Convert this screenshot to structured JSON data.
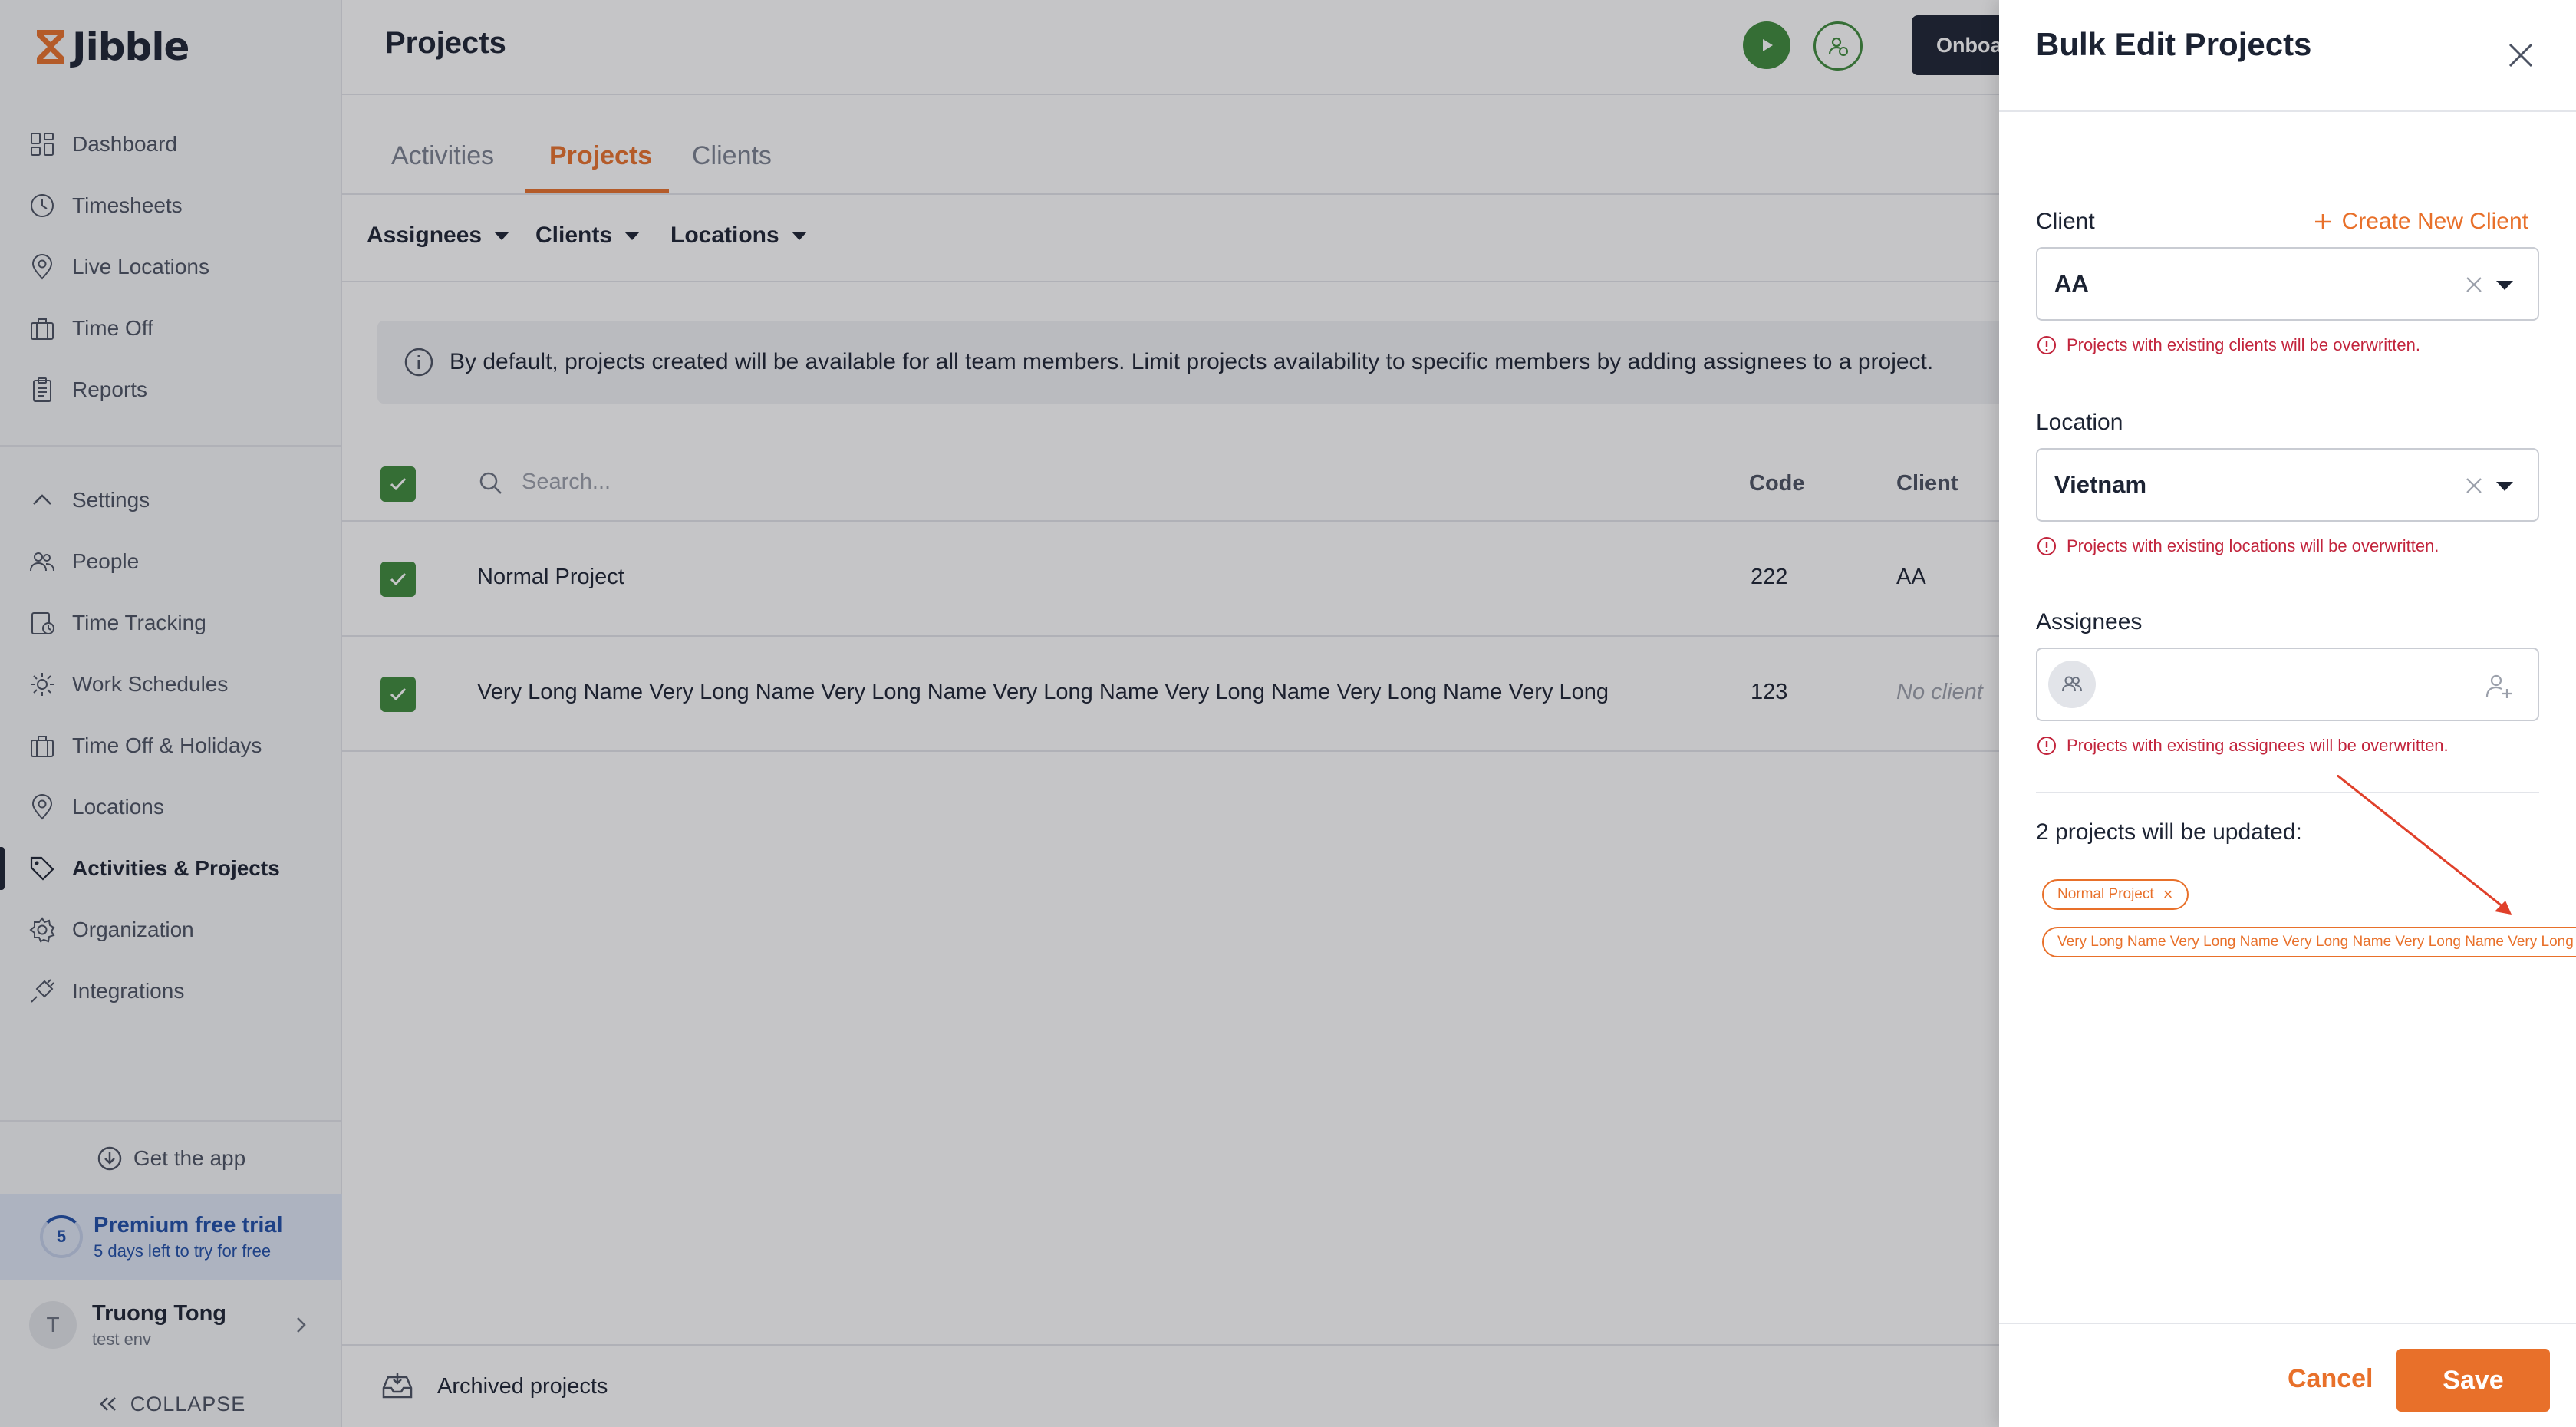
{
  "brand": {
    "name": "Jibble",
    "accent": "#e8702a",
    "green": "#3d8a3a",
    "dark": "#1c2333",
    "error": "#c2243c"
  },
  "sidebar": {
    "primary": [
      {
        "label": "Dashboard",
        "icon": "dashboard-icon"
      },
      {
        "label": "Timesheets",
        "icon": "clock-icon"
      },
      {
        "label": "Live Locations",
        "icon": "location-pin-icon"
      },
      {
        "label": "Time Off",
        "icon": "suitcase-icon"
      },
      {
        "label": "Reports",
        "icon": "clipboard-icon"
      }
    ],
    "settings_label": "Settings",
    "secondary": [
      {
        "label": "People",
        "icon": "people-icon"
      },
      {
        "label": "Time Tracking",
        "icon": "time-tracking-icon"
      },
      {
        "label": "Work Schedules",
        "icon": "schedule-icon"
      },
      {
        "label": "Time Off & Holidays",
        "icon": "suitcase-icon"
      },
      {
        "label": "Locations",
        "icon": "location-pin-icon"
      },
      {
        "label": "Activities & Projects",
        "icon": "tag-icon",
        "active": true
      },
      {
        "label": "Organization",
        "icon": "gear-icon"
      },
      {
        "label": "Integrations",
        "icon": "plug-icon"
      }
    ],
    "get_app": "Get the app",
    "trial": {
      "days": "5",
      "title": "Premium free trial",
      "subtitle": "5 days left to try for free"
    },
    "user": {
      "initial": "T",
      "name": "Truong Tong",
      "org": "test env"
    },
    "collapse": "COLLAPSE"
  },
  "header": {
    "title": "Projects",
    "onboarding_label": "Onboa"
  },
  "tabs": [
    "Activities",
    "Projects",
    "Clients"
  ],
  "filters": [
    "Assignees",
    "Clients",
    "Locations"
  ],
  "info_banner": "By default, projects created will be available for all team members. Limit projects availability to specific members by adding assignees to a project.",
  "table": {
    "search_placeholder": "Search...",
    "columns": [
      "Code",
      "Client"
    ],
    "rows": [
      {
        "name": "Normal Project",
        "code": "222",
        "client": "AA",
        "client_empty": false
      },
      {
        "name": "Very Long Name Very Long Name Very Long Name Very Long Name Very Long Name Very Long Name Very Long",
        "code": "123",
        "client": "No client",
        "client_empty": true
      }
    ]
  },
  "archived_label": "Archived projects",
  "drawer": {
    "title": "Bulk Edit Projects",
    "client_label": "Client",
    "create_client": "Create New Client",
    "client_value": "AA",
    "client_warning": "Projects with existing clients will be overwritten.",
    "location_label": "Location",
    "location_value": "Vietnam",
    "location_warning": "Projects with existing locations will be overwritten.",
    "assignees_label": "Assignees",
    "assignees_warning": "Projects with existing assignees will be overwritten.",
    "update_count": "2 projects will be updated:",
    "chips": [
      "Normal Project",
      "Very Long Name Very Long Name Very Long Name Very Long Name Very Long Name Very Long Name Very Long"
    ],
    "cancel": "Cancel",
    "save": "Save"
  }
}
